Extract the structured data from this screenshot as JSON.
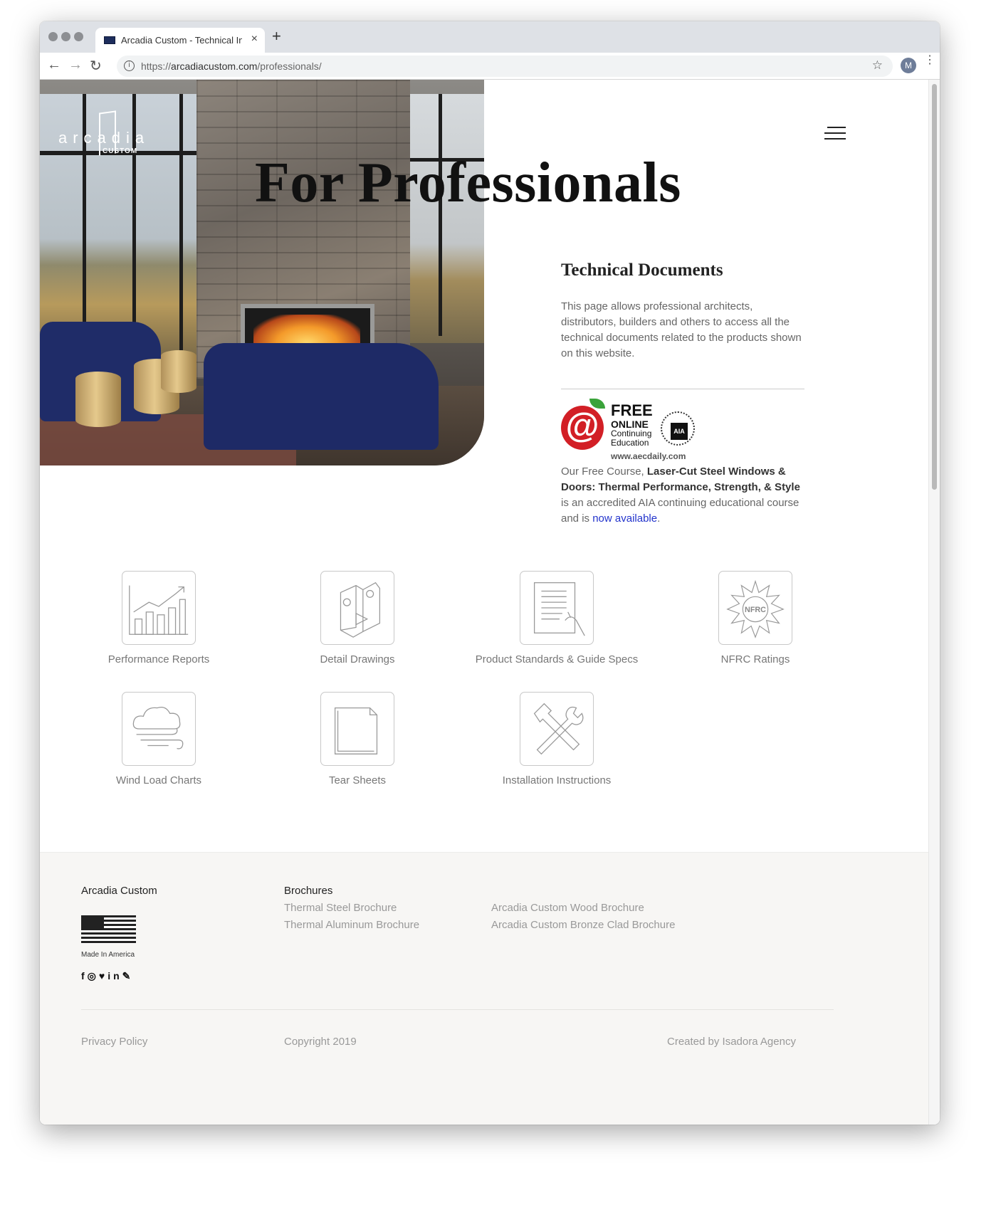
{
  "browser": {
    "tab_title": "Arcadia Custom - Technical Inf",
    "tab_close": "×",
    "new_tab": "+",
    "url_prefix": "https://",
    "url_host": "arcadiacustom.com",
    "url_path": "/professionals/",
    "avatar_letter": "M",
    "star": "☆",
    "back": "←",
    "forward": "→",
    "reload": "↻",
    "info": "i",
    "menu": "⋮"
  },
  "brand": {
    "logo_text": "arcadia",
    "logo_sub": "CUSTOM"
  },
  "hero": {
    "title": "For Professionals"
  },
  "technical": {
    "heading": "Technical Documents",
    "body": "This page allows professional architects, distributors, builders and others to access all the technical documents related to the products shown on this website."
  },
  "aec": {
    "free": "FREE",
    "online": "ONLINE",
    "continuing": "Continuing",
    "education": "Education",
    "url": "www.aecdaily.com",
    "at": "@",
    "aia": "AIA"
  },
  "course": {
    "prefix": "Our Free Course, ",
    "bold": "Laser-Cut Steel Windows & Doors: Thermal Performance, Strength, & Style",
    "middle": " is an accredited AIA continuing educational course and is ",
    "link": "now available",
    "suffix": "."
  },
  "documents": [
    {
      "label": "Performance Reports",
      "icon": "bar-chart-icon"
    },
    {
      "label": "Detail Drawings",
      "icon": "profile-drawing-icon"
    },
    {
      "label": "Product Standards & Guide Specs",
      "icon": "document-hand-icon"
    },
    {
      "label": "NFRC Ratings",
      "icon": "nfrc-seal-icon",
      "icon_text": "NFRC"
    },
    {
      "label": "Wind Load Charts",
      "icon": "cloud-wind-icon"
    },
    {
      "label": "Tear Sheets",
      "icon": "pages-icon"
    },
    {
      "label": "Installation Instructions",
      "icon": "tools-icon"
    }
  ],
  "footer": {
    "brand": "Arcadia Custom",
    "made_in": "Made In America",
    "socials": "f◎♥in✎",
    "brochures_title": "Brochures",
    "brochures": [
      "Thermal Steel Brochure",
      "Thermal Aluminum Brochure",
      "Arcadia Custom Wood Brochure",
      "Arcadia Custom Bronze Clad Brochure"
    ],
    "privacy": "Privacy Policy",
    "copyright": "Copyright 2019",
    "credits": "Created by Isadora Agency"
  }
}
